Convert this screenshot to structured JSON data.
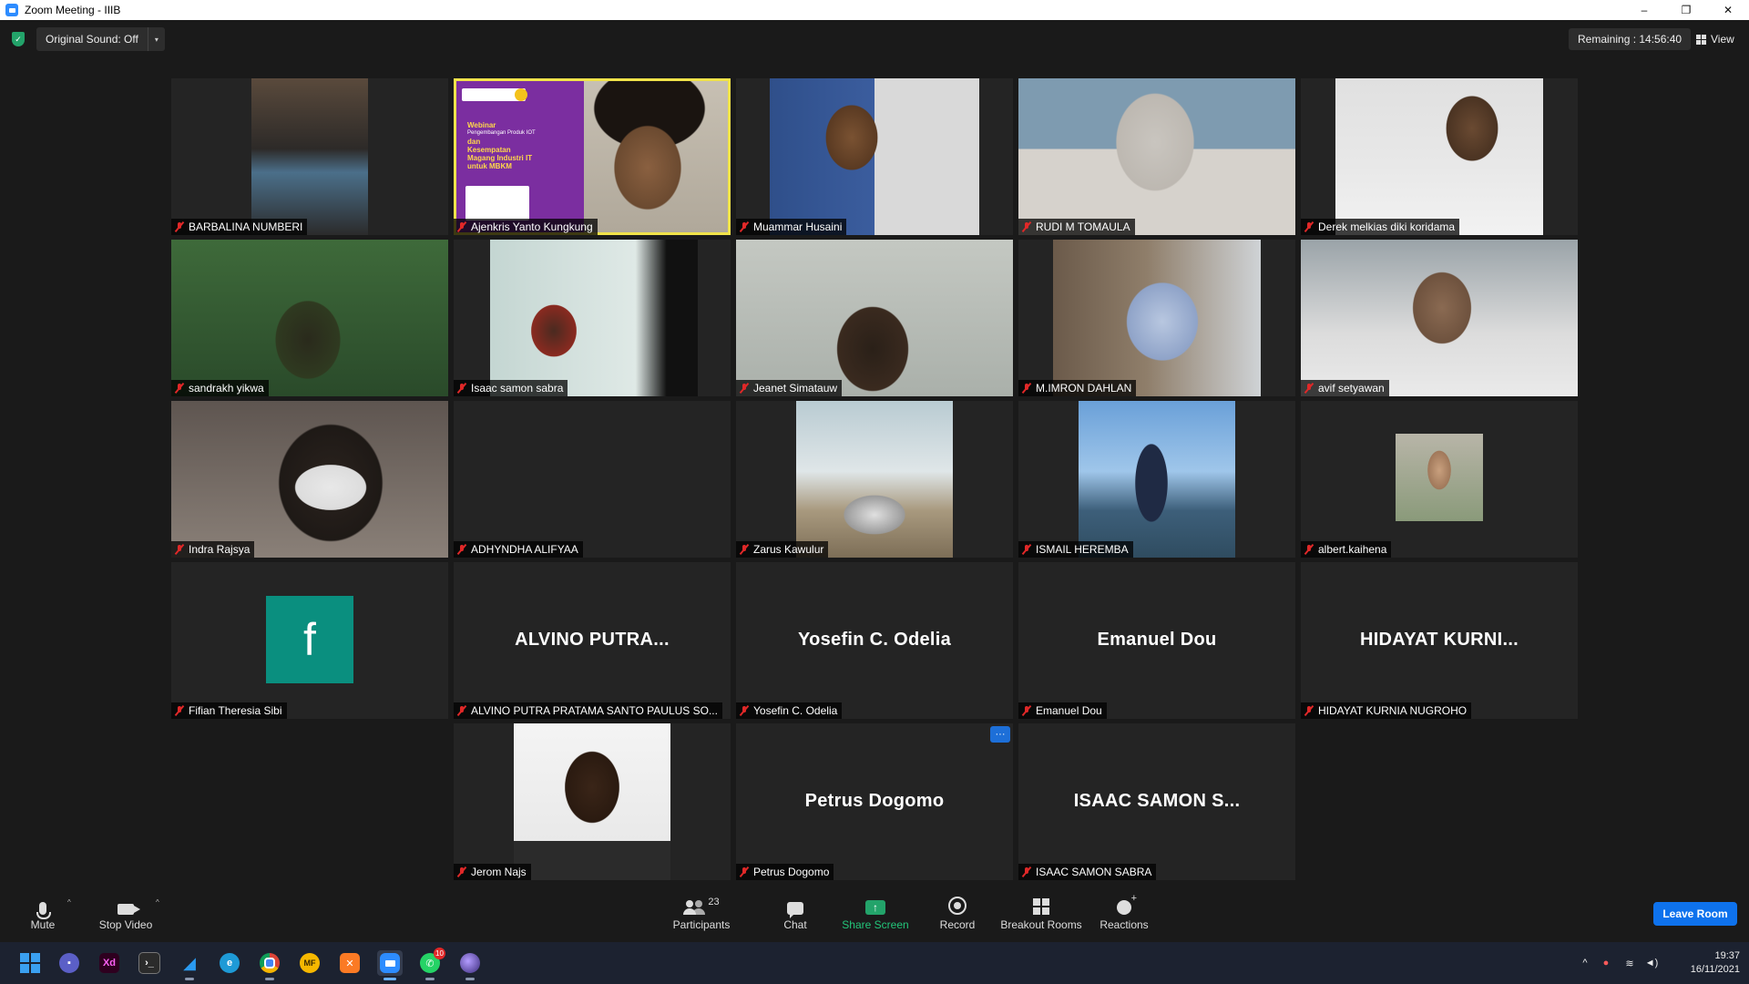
{
  "window": {
    "title": "Zoom Meeting - IIIB",
    "minimize": "–",
    "restore": "❐",
    "close": "✕"
  },
  "topbar": {
    "original_sound": "Original Sound: Off",
    "dropdown": "▾",
    "remaining": "Remaining : 14:56:40",
    "view": "View"
  },
  "tiles": [
    {
      "name": "BARBALINA NUMBERI",
      "big": ""
    },
    {
      "name": "Ajenkris Yanto Kungkung",
      "big": "",
      "active": true
    },
    {
      "name": "Muammar Husaini",
      "big": ""
    },
    {
      "name": "RUDI M TOMAULA",
      "big": ""
    },
    {
      "name": "Derek melkias diki koridama",
      "big": ""
    },
    {
      "name": "sandrakh yikwa",
      "big": ""
    },
    {
      "name": "Isaac samon sabra",
      "big": ""
    },
    {
      "name": "Jeanet Simatauw",
      "big": ""
    },
    {
      "name": "M.IMRON DAHLAN",
      "big": ""
    },
    {
      "name": "avif setyawan",
      "big": ""
    },
    {
      "name": "Indra Rajsya",
      "big": ""
    },
    {
      "name": "ADHYNDHA ALIFYAA",
      "big": ""
    },
    {
      "name": "Zarus Kawulur",
      "big": ""
    },
    {
      "name": "ISMAIL HEREMBA",
      "big": ""
    },
    {
      "name": "albert.kaihena",
      "big": ""
    },
    {
      "name": "Fifian Theresia Sibi",
      "big": "",
      "avatar_letter": "f"
    },
    {
      "name": "ALVINO PUTRA PRATAMA SANTO PAULUS SO...",
      "big": "ALVINO  PUTRA..."
    },
    {
      "name": "Yosefin C. Odelia",
      "big": "Yosefin C. Odelia"
    },
    {
      "name": "Emanuel Dou",
      "big": "Emanuel Dou"
    },
    {
      "name": "HIDAYAT KURNIA NUGROHO",
      "big": "HIDAYAT  KURNI..."
    },
    {
      "name": "Jerom Najs",
      "big": ""
    },
    {
      "name": "Petrus Dogomo",
      "big": "Petrus Dogomo",
      "more": "···"
    },
    {
      "name": "ISAAC SAMON SABRA",
      "big": "ISAAC  SAMON  S..."
    }
  ],
  "slide": {
    "text": [
      "Webinar",
      "Pengembangan Produk IOT",
      "dan",
      "Kesempatan",
      "Magang Industri IT",
      "untuk MBKM"
    ]
  },
  "toolbar": {
    "mute": "Mute",
    "stop_video": "Stop Video",
    "participants": "Participants",
    "participants_count": "23",
    "chat": "Chat",
    "share_screen": "Share Screen",
    "record": "Record",
    "breakout_rooms": "Breakout Rooms",
    "reactions": "Reactions",
    "leave": "Leave Room",
    "caret": "^"
  },
  "taskbar": {
    "apps": [
      "windows-start",
      "teams",
      "adobe-xd",
      "terminal",
      "vscode",
      "edge",
      "chrome",
      "mf",
      "xampp",
      "zoom",
      "whatsapp",
      "obs"
    ],
    "xd_label": "Xd",
    "mf_label": "MF",
    "whatsapp_badge": "10",
    "time": "19:37",
    "date": "16/11/2021",
    "tray_chevron": "^"
  },
  "colors": {
    "active_speaker": "#f1e34a",
    "share_green": "#23a36a",
    "leave_blue": "#0e72ed",
    "muted_red": "#e02828"
  }
}
